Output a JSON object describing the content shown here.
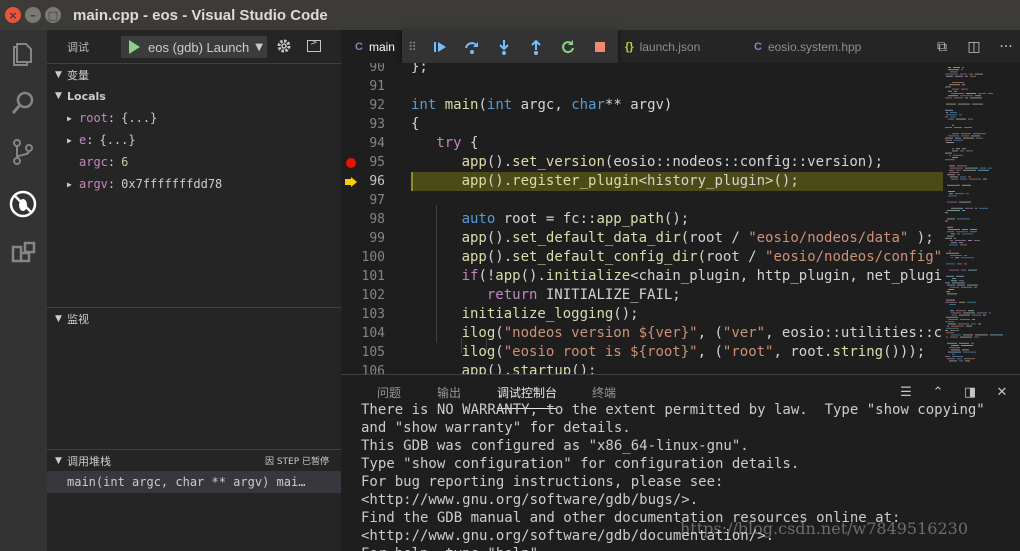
{
  "window": {
    "title": "main.cpp - eos - Visual Studio Code"
  },
  "activity": [
    "explorer-icon",
    "search-icon",
    "source-control-icon",
    "debug-icon",
    "extensions-icon"
  ],
  "sidebar": {
    "debug_title": "调试",
    "launch_config": "eos (gdb) Launch",
    "variables_title": "变量",
    "locals_title": "Locals",
    "variables": [
      {
        "name": "root",
        "value": "{...}",
        "expandable": true,
        "numeric": false
      },
      {
        "name": "e",
        "value": "{...}",
        "expandable": true,
        "numeric": false
      },
      {
        "name": "argc",
        "value": "6",
        "expandable": false,
        "numeric": true
      },
      {
        "name": "argv",
        "value": "0x7fffffffdd78",
        "expandable": true,
        "numeric": false
      }
    ],
    "watch_title": "监视",
    "callstack_title": "调用堆栈",
    "callstack_status": "因 STEP 已暂停",
    "callstack_frames": [
      "main(int argc, char ** argv)  mai…"
    ]
  },
  "tabs": [
    {
      "label": "main",
      "icon": "C",
      "active": true
    },
    {
      "label": "launch.json",
      "icon": "{}",
      "active": false
    },
    {
      "label": "eosio.system.hpp",
      "icon": "C",
      "active": false
    }
  ],
  "debug_controls": [
    "continue-icon",
    "step-over-icon",
    "step-into-icon",
    "step-out-icon",
    "restart-icon",
    "stop-icon"
  ],
  "editor": {
    "current_line": 96,
    "breakpoint_line": 95,
    "lines": [
      {
        "n": "90",
        "t": "};"
      },
      {
        "n": "91",
        "t": ""
      },
      {
        "n": "92",
        "t": "int main(int argc, char** argv)"
      },
      {
        "n": "93",
        "t": "{"
      },
      {
        "n": "94",
        "t": "   try {"
      },
      {
        "n": "95",
        "t": "      app().set_version(eosio::nodeos::config::version);"
      },
      {
        "n": "96",
        "t": "      app().register_plugin<history_plugin>();"
      },
      {
        "n": "97",
        "t": ""
      },
      {
        "n": "98",
        "t": "      auto root = fc::app_path();"
      },
      {
        "n": "99",
        "t": "      app().set_default_data_dir(root / \"eosio/nodeos/data\" );"
      },
      {
        "n": "100",
        "t": "      app().set_default_config_dir(root / \"eosio/nodeos/config\""
      },
      {
        "n": "101",
        "t": "      if(!app().initialize<chain_plugin, http_plugin, net_plugin"
      },
      {
        "n": "102",
        "t": "         return INITIALIZE_FAIL;"
      },
      {
        "n": "103",
        "t": "      initialize_logging();"
      },
      {
        "n": "104",
        "t": "      ilog(\"nodeos version ${ver}\", (\"ver\", eosio::utilities::co"
      },
      {
        "n": "105",
        "t": "      ilog(\"eosio root is ${root}\", (\"root\", root.string()));"
      },
      {
        "n": "106",
        "t": "      app().startup();"
      }
    ]
  },
  "panel": {
    "tabs": [
      "问题",
      "输出",
      "调试控制台",
      "终端"
    ],
    "active_tab": "调试控制台",
    "console_lines": [
      "There is NO WARRANTY, to the extent permitted by law.  Type \"show copying\"",
      "and \"show warranty\" for details.",
      "This GDB was configured as \"x86_64-linux-gnu\".",
      "Type \"show configuration\" for configuration details.",
      "For bug reporting instructions, please see:",
      "<http://www.gnu.org/software/gdb/bugs/>.",
      "Find the GDB manual and other documentation resources online at:",
      "<http://www.gnu.org/software/gdb/documentation/>.",
      "For help, type \"help\"."
    ]
  },
  "watermark": "https://blog.csdn.net/w7849516230"
}
